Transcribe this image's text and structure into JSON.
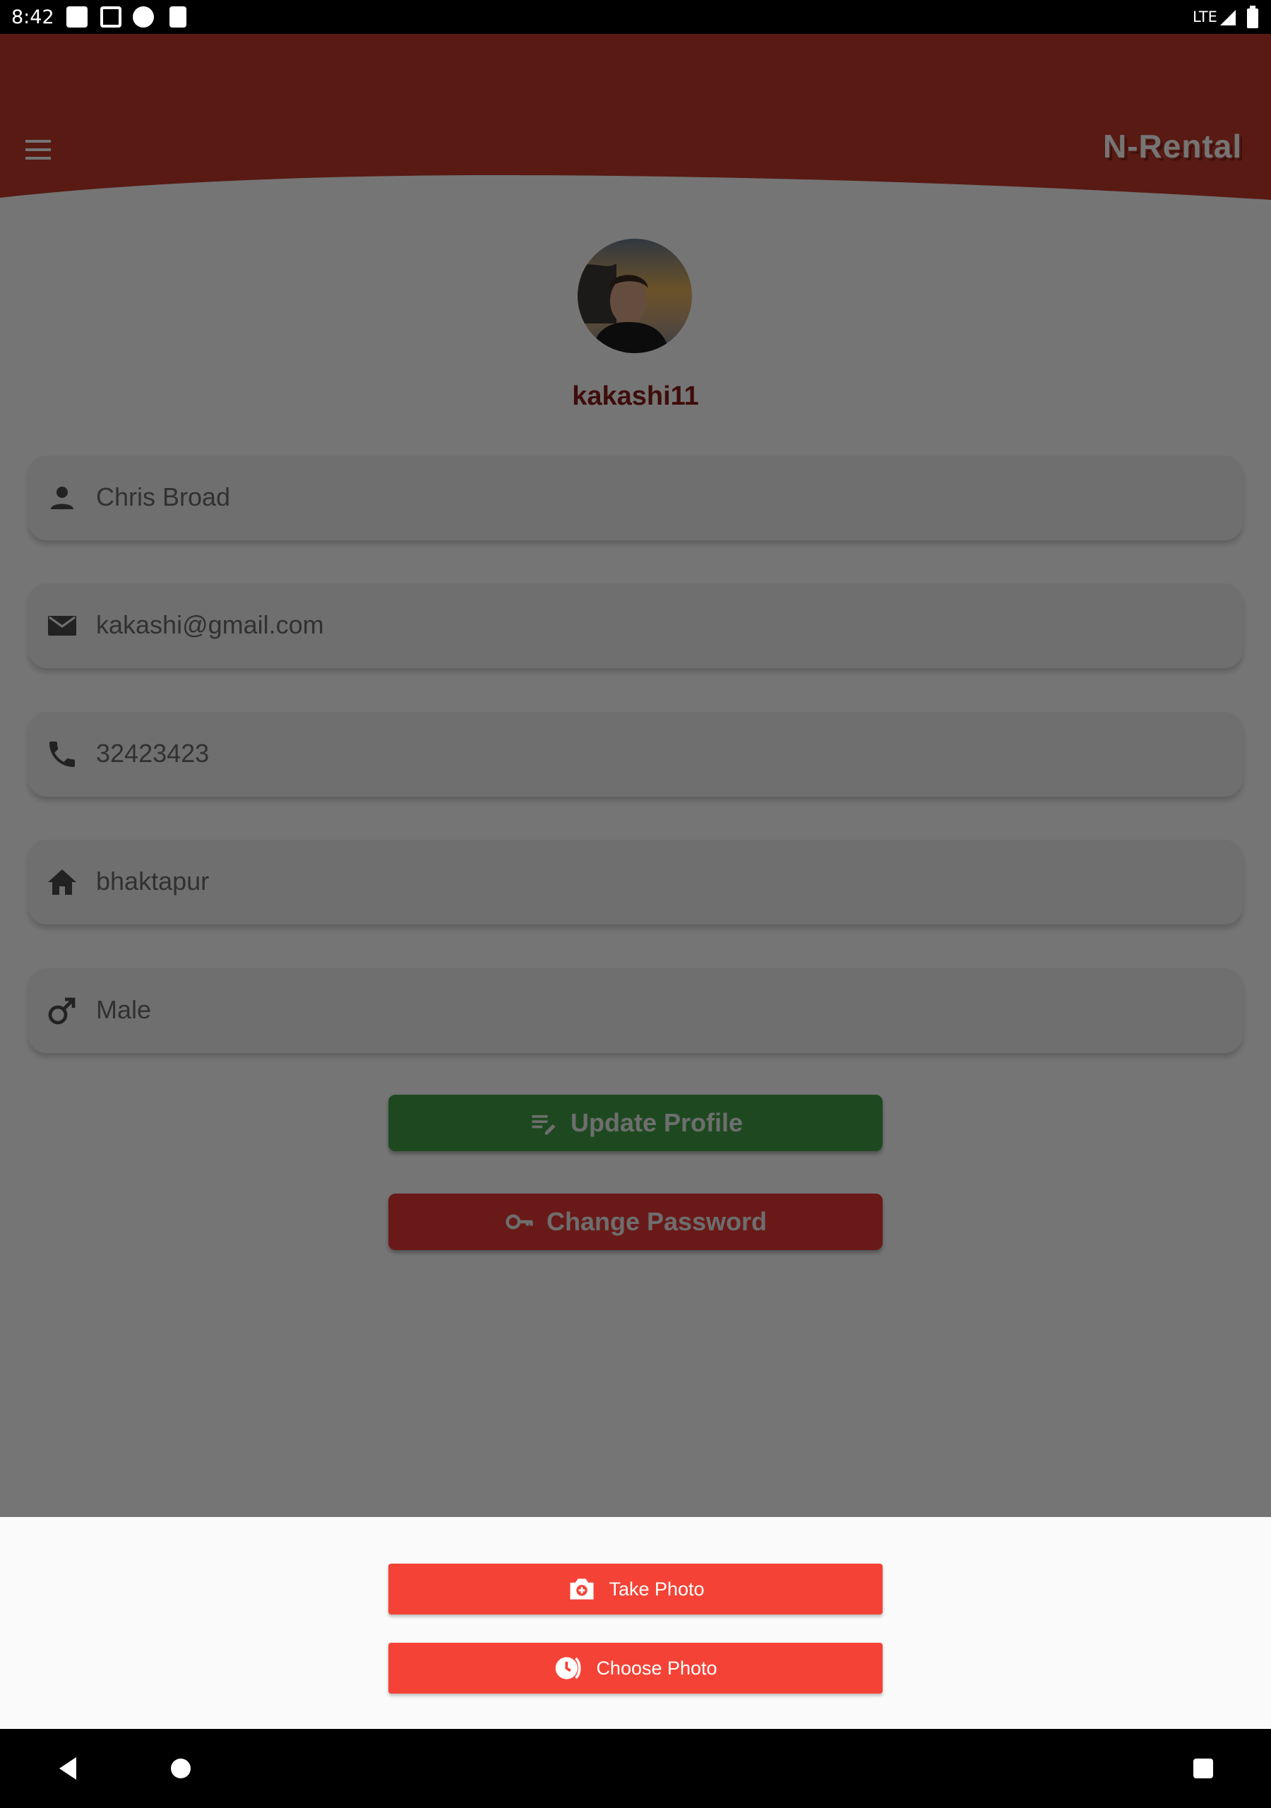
{
  "status_bar": {
    "time": "8:42",
    "network": "LTE"
  },
  "header": {
    "logo_text": "N-Rental",
    "color": "#c0392b",
    "menu_icon": "menu-icon"
  },
  "profile": {
    "username": "kakashi11",
    "fields": [
      {
        "icon": "person-icon",
        "value": "Chris Broad"
      },
      {
        "icon": "email-icon",
        "value": "kakashi@gmail.com"
      },
      {
        "icon": "phone-icon",
        "value": "32423423"
      },
      {
        "icon": "home-icon",
        "value": "bhaktapur"
      },
      {
        "icon": "male-icon",
        "value": "Male"
      }
    ]
  },
  "actions": {
    "update_label": "Update Profile",
    "update_color": "#43a047",
    "password_label": "Change Password",
    "password_color": "#e53935"
  },
  "photo_sheet": {
    "take_label": "Take Photo",
    "choose_label": "Choose Photo",
    "color": "#f44336"
  }
}
